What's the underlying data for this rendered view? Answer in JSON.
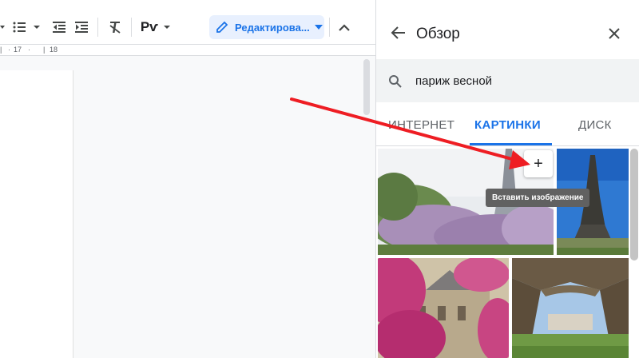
{
  "toolbar": {
    "bullet_list_icon": "bulleted-list-icon",
    "decrease_indent_icon": "decrease-indent-icon",
    "increase_indent_icon": "increase-indent-icon",
    "clear_format_icon": "clear-formatting-icon",
    "spellcheck_label": "Рѵ",
    "editing_mode_label": "Редактирова...",
    "collapse_icon": "chevron-up-icon"
  },
  "ruler": {
    "marks": [
      "17",
      "18"
    ]
  },
  "explore_panel": {
    "title": "Обзор",
    "search_query": "париж весной",
    "tabs": [
      {
        "label": "ИНТЕРНЕТ",
        "active": false
      },
      {
        "label": "КАРТИНКИ",
        "active": true
      },
      {
        "label": "ДИСК",
        "active": false
      }
    ],
    "insert_button_label": "+",
    "insert_tooltip": "Вставить изображение",
    "accent_color": "#1a73e8"
  },
  "annotation": {
    "arrow_color": "#ee1d23"
  }
}
